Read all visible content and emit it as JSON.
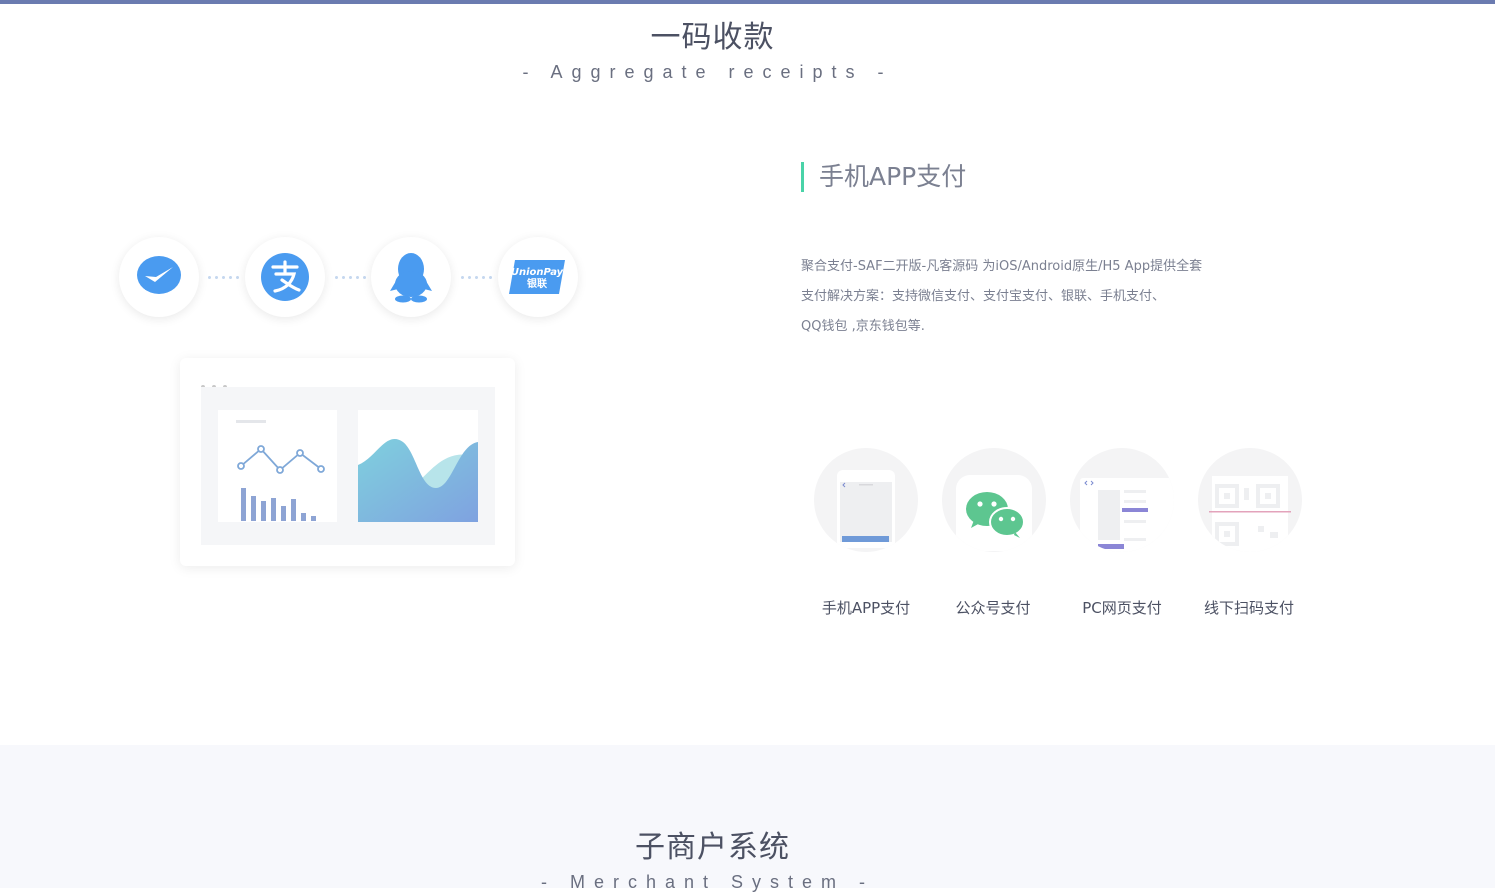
{
  "section1": {
    "title": "一码收款",
    "subtitle": "- Aggregate receipts -"
  },
  "payment_icons": [
    {
      "name": "wechat-pay",
      "color": "#4a9bf0"
    },
    {
      "name": "alipay",
      "color": "#4a9bf0"
    },
    {
      "name": "qq-wallet",
      "color": "#4a9bf0"
    },
    {
      "name": "unionpay",
      "color": "#4a9bf0",
      "text_top": "UnionPay",
      "text_bottom": "银联"
    }
  ],
  "feature": {
    "title": "手机APP支付",
    "desc_line1": "聚合支付-SAF二开版-凡客源码 为iOS/Android原生/H5 App提供全套",
    "desc_line2": "支付解决方案：支持微信支付、支付宝支付、银联、手机支付、",
    "desc_line3": "QQ钱包 ,京东钱包等."
  },
  "modes": [
    {
      "label": "手机APP支付",
      "icon": "phone-app-icon"
    },
    {
      "label": "公众号支付",
      "icon": "wechat-icon"
    },
    {
      "label": "PC网页支付",
      "icon": "pc-web-icon"
    },
    {
      "label": "线下扫码支付",
      "icon": "qr-code-icon"
    }
  ],
  "section2": {
    "title": "子商户系统",
    "subtitle": "- Merchant System -"
  },
  "colors": {
    "accent_bar": "#6b7bb0",
    "feature_marker": "#49d3a8",
    "icon_blue": "#4a9bf0",
    "wechat_green": "#5dc690"
  }
}
